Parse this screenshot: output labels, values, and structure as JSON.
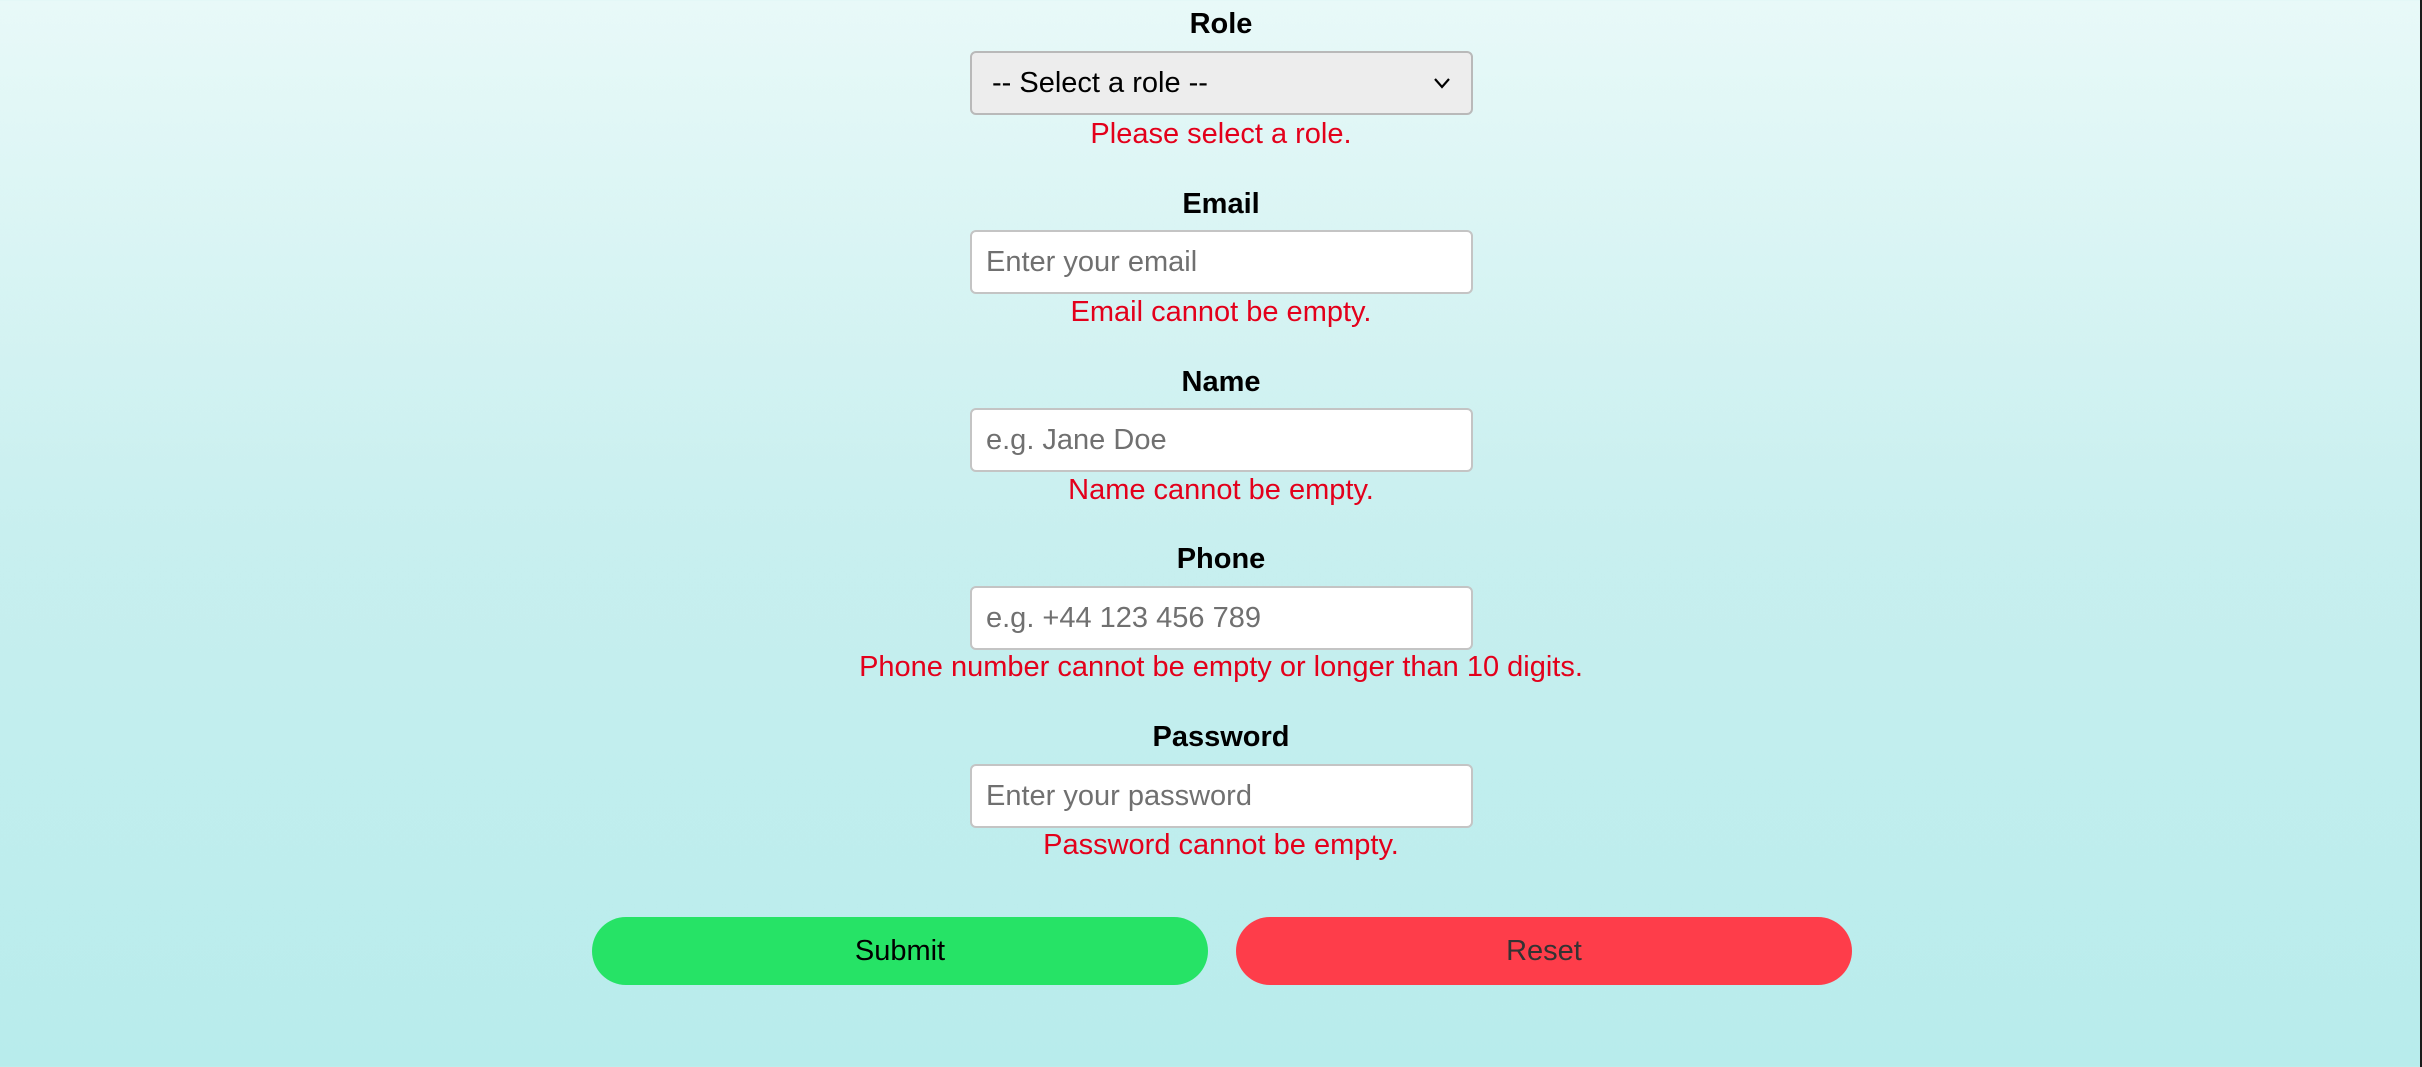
{
  "form": {
    "role": {
      "label": "Role",
      "selected": "-- Select a role --",
      "error": "Please select a role."
    },
    "email": {
      "label": "Email",
      "value": "",
      "placeholder": "Enter your email",
      "error": "Email cannot be empty."
    },
    "name": {
      "label": "Name",
      "value": "",
      "placeholder": "e.g. Jane Doe",
      "error": "Name cannot be empty."
    },
    "phone": {
      "label": "Phone",
      "value": "",
      "placeholder": "e.g. +44 123 456 789",
      "error": "Phone number cannot be empty or longer than 10 digits."
    },
    "password": {
      "label": "Password",
      "value": "",
      "placeholder": "Enter your password",
      "error": "Password cannot be empty."
    }
  },
  "actions": {
    "submit_label": "Submit",
    "reset_label": "Reset"
  },
  "colors": {
    "error": "#e3001b",
    "submit": "#26e366",
    "reset": "#fe3d4a",
    "background_top": "#e8f9f8",
    "background_bottom": "#b8ecec"
  },
  "icons": {
    "select_arrow": "chevron-down-icon"
  }
}
